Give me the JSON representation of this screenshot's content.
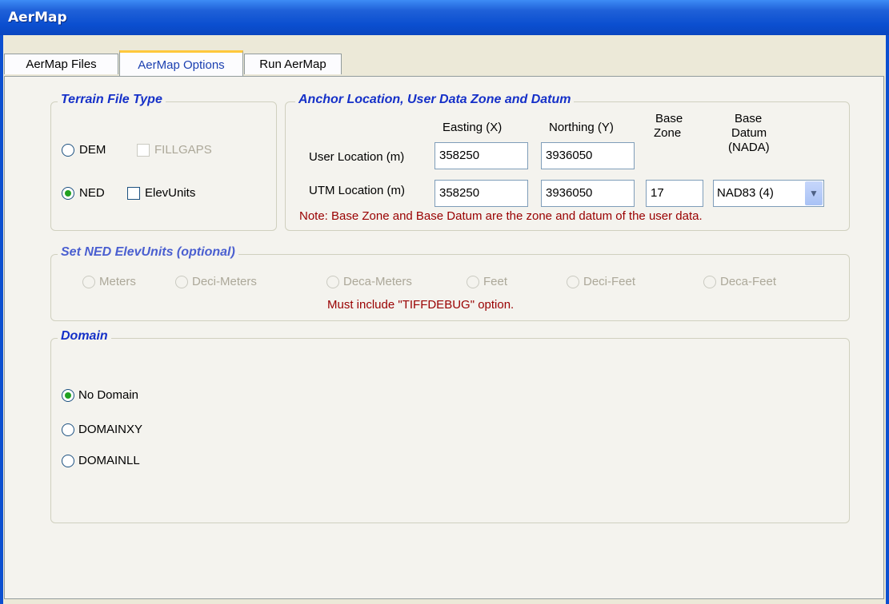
{
  "window": {
    "title": "AerMap"
  },
  "tabs": [
    {
      "label": "AerMap Files"
    },
    {
      "label": "AerMap Options"
    },
    {
      "label": "Run AerMap"
    }
  ],
  "terrain": {
    "legend": "Terrain File Type",
    "dem_label": "DEM",
    "fillgaps_label": "FILLGAPS",
    "ned_label": "NED",
    "elevunits_label": "ElevUnits",
    "selected": "NED"
  },
  "anchor": {
    "legend": "Anchor Location, User Data Zone and Datum",
    "col_easting": "Easting (X)",
    "col_northing": "Northing (Y)",
    "col_zone_1": "Base",
    "col_zone_2": "Zone",
    "col_datum_1": "Base",
    "col_datum_2": "Datum",
    "col_datum_3": "(NADA)",
    "user_label": "User Location (m)",
    "user_easting": "358250",
    "user_northing": "3936050",
    "utm_label": "UTM Location (m)",
    "utm_easting": "358250",
    "utm_northing": "3936050",
    "utm_zone": "17",
    "utm_datum": "NAD83 (4)",
    "note": "Note: Base Zone and Base Datum are the zone and datum of the user data."
  },
  "ned_units": {
    "legend": "Set NED ElevUnits (optional)",
    "options": [
      "Meters",
      "Deci-Meters",
      "Deca-Meters",
      "Feet",
      "Deci-Feet",
      "Deca-Feet"
    ],
    "note": "Must include \"TIFFDEBUG\" option."
  },
  "domain": {
    "legend": "Domain",
    "options": [
      "No Domain",
      "DOMAINXY",
      "DOMAINLL"
    ],
    "selected": "No Domain"
  }
}
